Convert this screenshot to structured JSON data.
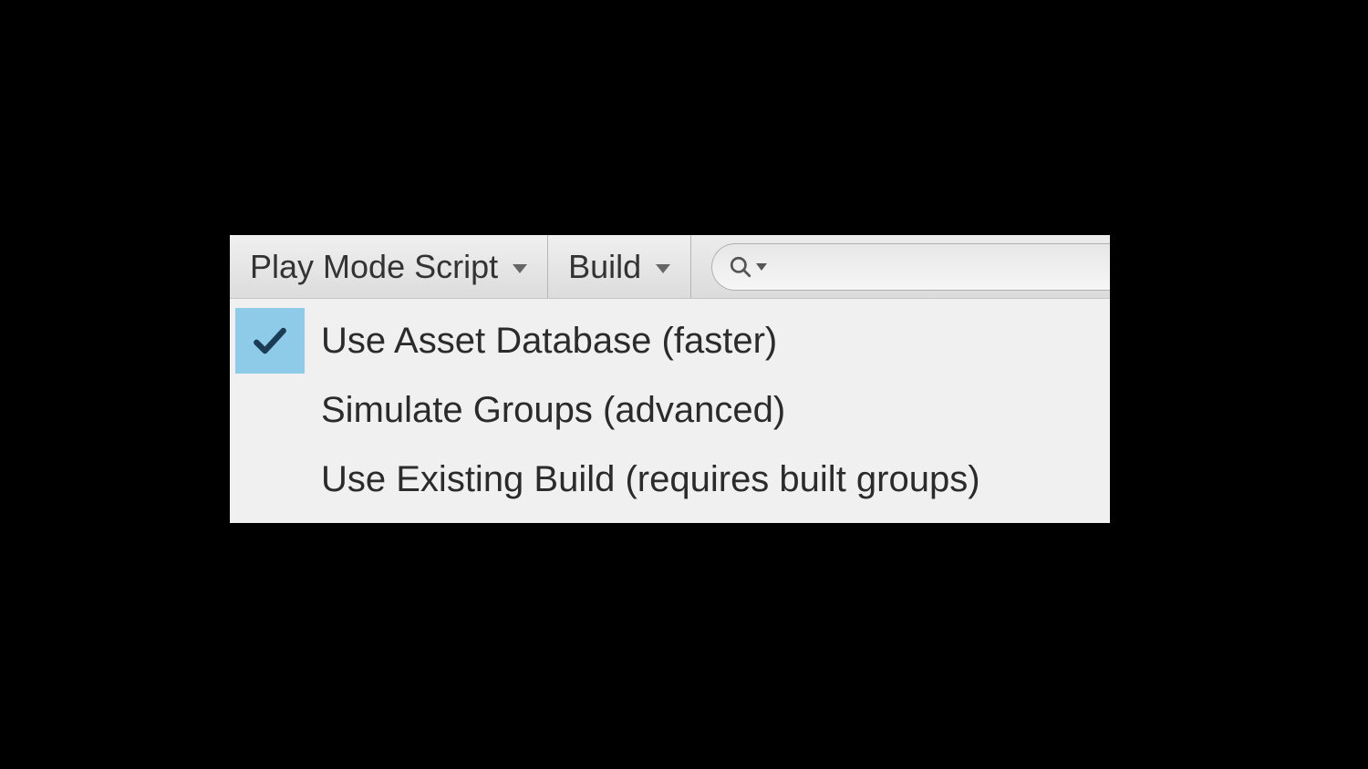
{
  "toolbar": {
    "playModeScript": {
      "label": "Play Mode Script"
    },
    "build": {
      "label": "Build"
    }
  },
  "dropdown": {
    "items": [
      {
        "label": "Use Asset Database (faster)",
        "selected": true
      },
      {
        "label": "Simulate Groups (advanced)",
        "selected": false
      },
      {
        "label": "Use Existing Build (requires built groups)",
        "selected": false
      }
    ]
  }
}
